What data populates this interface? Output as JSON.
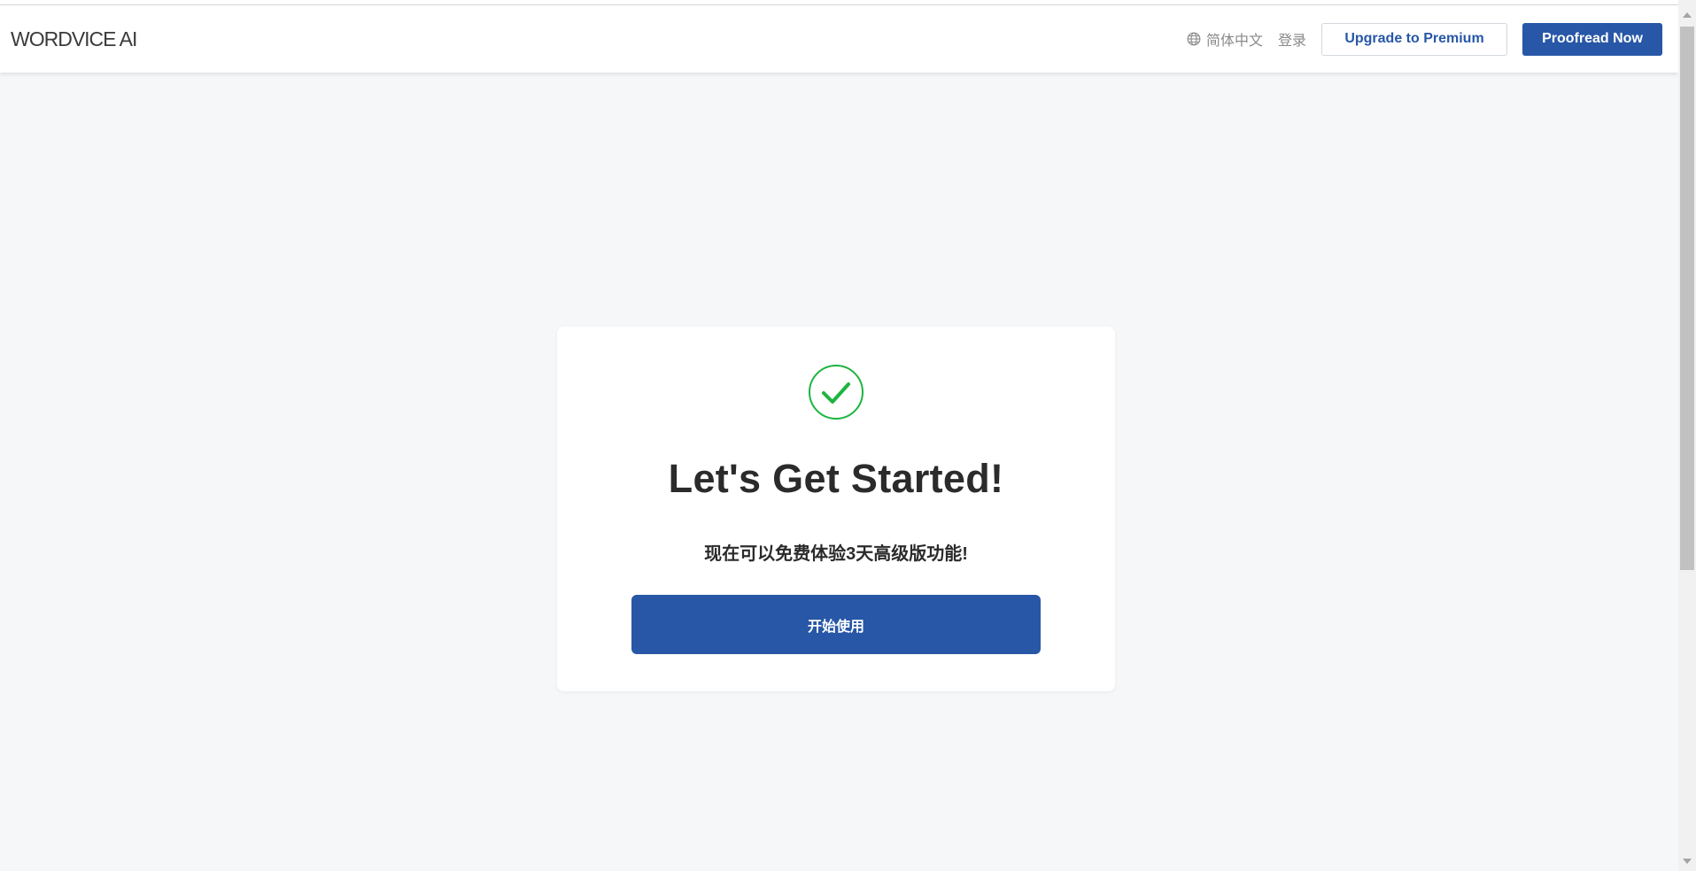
{
  "header": {
    "logo": "WORDVICE AI",
    "language_label": "简体中文",
    "login_label": "登录",
    "upgrade_label": "Upgrade to Premium",
    "proofread_label": "Proofread Now"
  },
  "card": {
    "icon": "check-circle-icon",
    "title": "Let's Get Started!",
    "subtitle": "现在可以免费体验3天高级版功能!",
    "start_label": "开始使用"
  },
  "colors": {
    "brand_blue": "#2757a6",
    "success_green": "#1db43f",
    "background": "#f6f7f9"
  }
}
